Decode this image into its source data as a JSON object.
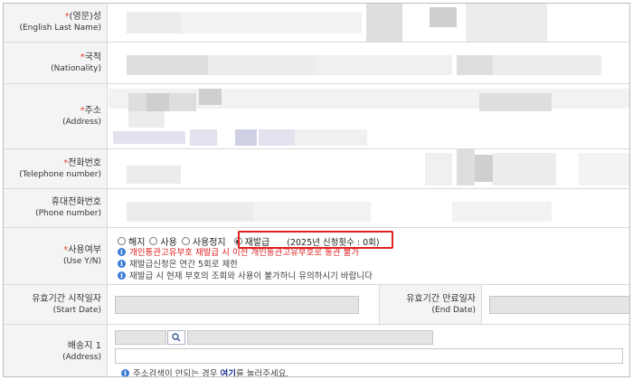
{
  "rows": {
    "last_name": {
      "label_ko": "(영문)성",
      "label_en": "(English Last Name)",
      "required_mark": "*"
    },
    "nationality": {
      "label_ko": "국적",
      "label_en": "(Nationality)",
      "required_mark": "*"
    },
    "address": {
      "label_ko": "주소",
      "label_en": "(Address)",
      "required_mark": "*"
    },
    "telephone": {
      "label_ko": "전화번호",
      "label_en": "(Telephone number)",
      "required_mark": "*"
    },
    "phone": {
      "label_ko": "휴대전화번호",
      "label_en": "(Phone number)"
    },
    "use_yn": {
      "label_ko": "사용여부",
      "label_en": "(Use Y/N)",
      "required_mark": "*",
      "options": [
        "해지",
        "사용",
        "사용정지",
        "재발급"
      ],
      "selected": "재발급",
      "count_note": "(2025년 신청횟수 : 0회)",
      "info_red": "개인통관고유부호 재발급 시 이전 개인통관고유부호로 통관 불가",
      "info_1": "재발급신청은 연간 5회로 제한",
      "info_2": "재발급 시 현재 부호의 조회와 사용이 불가하니 유의하시기 바랍니다"
    },
    "validity": {
      "start_ko": "유효기간 시작일자",
      "start_en": "(Start Date)",
      "end_ko": "유효기간 만료일자",
      "end_en": "(End Date)"
    },
    "delivery": {
      "label_ko": "배송지 1",
      "label_en": "(Address)",
      "help_before": "주소검색이 안되는 경우",
      "help_link": "여기",
      "help_after": "를 눌러주세요."
    }
  },
  "icons": {
    "info": "info-icon",
    "search": "search-icon",
    "radio": "radio-button"
  },
  "colors": {
    "required": "#e0452f",
    "highlight": "#e02020",
    "info_icon": "#3b7bd6",
    "link": "#1a2e8a"
  }
}
